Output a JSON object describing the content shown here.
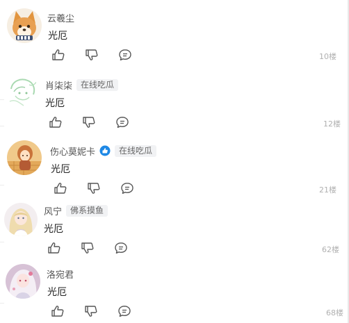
{
  "comments": [
    {
      "username": "云羲尘",
      "badge": "",
      "verified": false,
      "text": "光厄",
      "floor": "10楼"
    },
    {
      "username": "肖柒柒",
      "badge": "在线吃瓜",
      "verified": false,
      "text": "光厄",
      "floor": "12楼"
    },
    {
      "username": "伤心莫妮卡",
      "badge": "在线吃瓜",
      "verified": true,
      "text": "光厄",
      "floor": "21楼"
    },
    {
      "username": "风宁",
      "badge": "佛系摸鱼",
      "verified": false,
      "text": "光厄",
      "floor": "62楼"
    },
    {
      "username": "洛宛君",
      "badge": "",
      "verified": false,
      "text": "光厄",
      "floor": "68楼"
    }
  ],
  "icons": {
    "like": "thumbs-up-icon",
    "dislike": "thumbs-down-icon",
    "reply": "comment-icon",
    "verified": "verified-badge-icon"
  },
  "colors": {
    "icon": "#555555",
    "floor": "#b0b0b0",
    "badge_bg": "#f1f2f4",
    "verified": "#1e88e5"
  }
}
